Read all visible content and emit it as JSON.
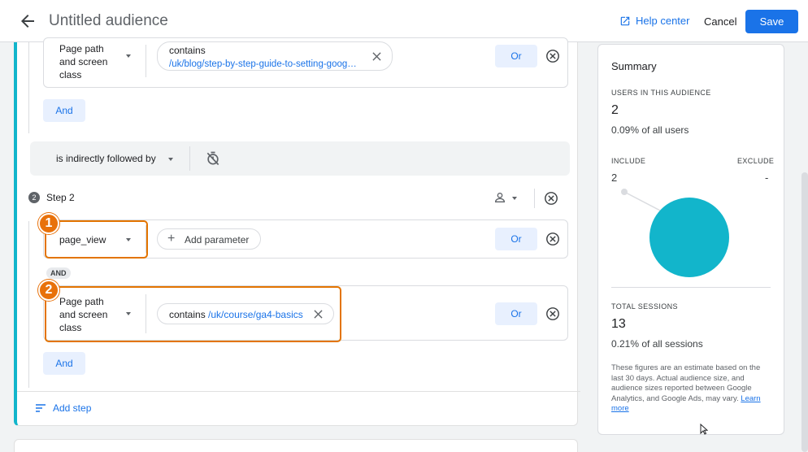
{
  "header": {
    "title": "Untitled audience",
    "help_label": "Help center",
    "cancel_label": "Cancel",
    "save_label": "Save"
  },
  "step1": {
    "condition_field": "Page path and screen class",
    "condition_op": "contains",
    "condition_value": "/uk/blog/step-by-step-guide-to-setting-goog…",
    "or_label": "Or",
    "and_label": "And"
  },
  "sequence": {
    "relation": "is indirectly followed by"
  },
  "step2": {
    "number": "2",
    "title": "Step 2",
    "event_field": "page_view",
    "add_parameter_label": "Add parameter",
    "or_label": "Or",
    "and_tag": "AND",
    "condition_field": "Page path and screen class",
    "condition_op": "contains",
    "condition_value": "/uk/course/ga4-basics",
    "or2_label": "Or",
    "and_label": "And"
  },
  "badges": {
    "one": "1",
    "two": "2"
  },
  "add_step_label": "Add step",
  "summary": {
    "title": "Summary",
    "users_label": "USERS IN THIS AUDIENCE",
    "users_value": "2",
    "users_pct": "0.09% of all users",
    "include_label": "INCLUDE",
    "exclude_label": "EXCLUDE",
    "include_value": "2",
    "exclude_value": "-",
    "sessions_label": "TOTAL SESSIONS",
    "sessions_value": "13",
    "sessions_pct": "0.21% of all sessions",
    "note": "These figures are an estimate based on the last 30 days. Actual audience size, and audience sizes reported between Google Analytics, and Google Ads, may vary.",
    "learn_more": "Learn more"
  },
  "colors": {
    "accent": "#1a73e8",
    "highlight": "#e8710a",
    "teal": "#12b5cb"
  }
}
